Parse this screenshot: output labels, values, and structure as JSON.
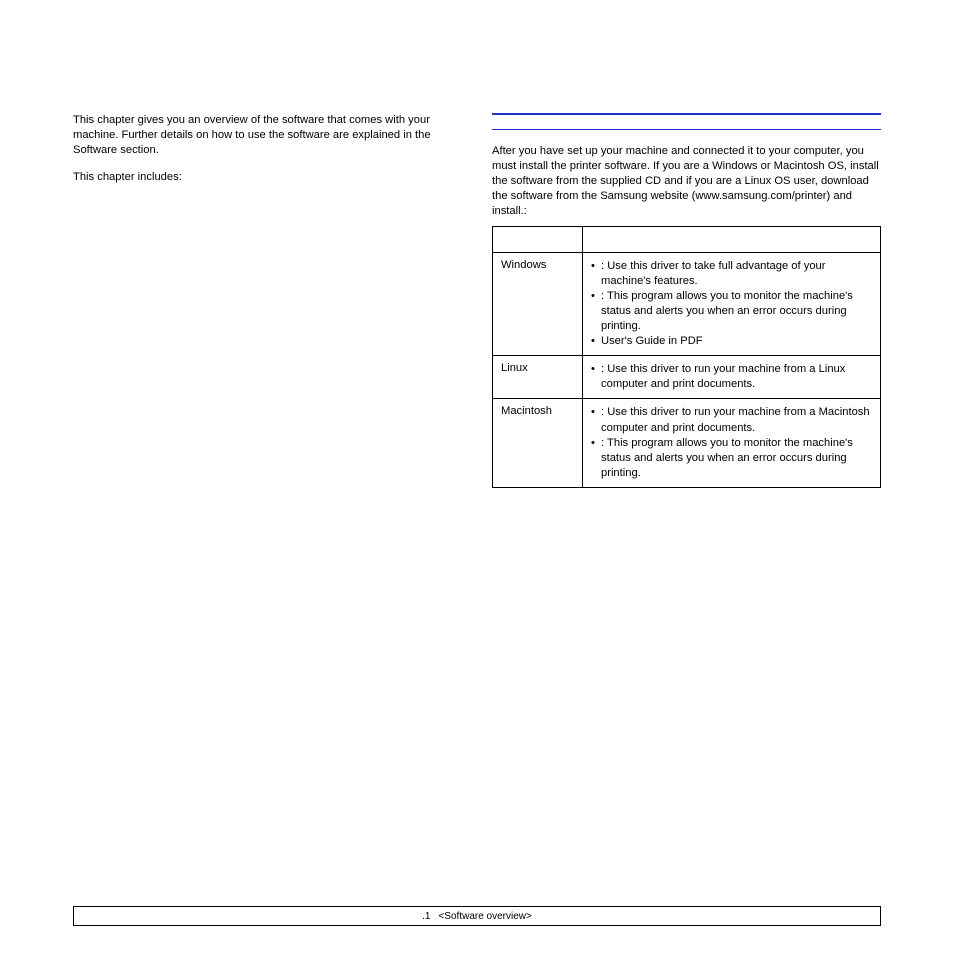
{
  "left": {
    "p1": "This chapter gives you an overview of the software that comes with your machine. Further details on how to use the software are explained in the Software section.",
    "p2": "This chapter includes:"
  },
  "right": {
    "intro": "After you have set up your machine and connected it to your computer, you must install the printer software. If you are a Windows or Macintosh OS, install the software from the supplied CD and if you are a Linux OS user, download the software from the Samsung website (www.samsung.com/printer) and install.:"
  },
  "table": {
    "rows": [
      {
        "os": "Windows",
        "items": [
          ": Use this driver to take full advantage of your machine's features.",
          ": This program allows you to monitor the machine's status and alerts you when an error occurs during printing.",
          "User's Guide in PDF"
        ]
      },
      {
        "os": "Linux",
        "items": [
          ": Use this driver to run your machine from a Linux computer and print documents."
        ]
      },
      {
        "os": "Macintosh",
        "items": [
          ": Use this driver to run your machine from a Macintosh computer and print documents.",
          ": This program allows you to monitor the machine's status and alerts you when an error occurs during printing."
        ]
      }
    ]
  },
  "footer": {
    "page": ".1",
    "section": "<Software overview>"
  }
}
